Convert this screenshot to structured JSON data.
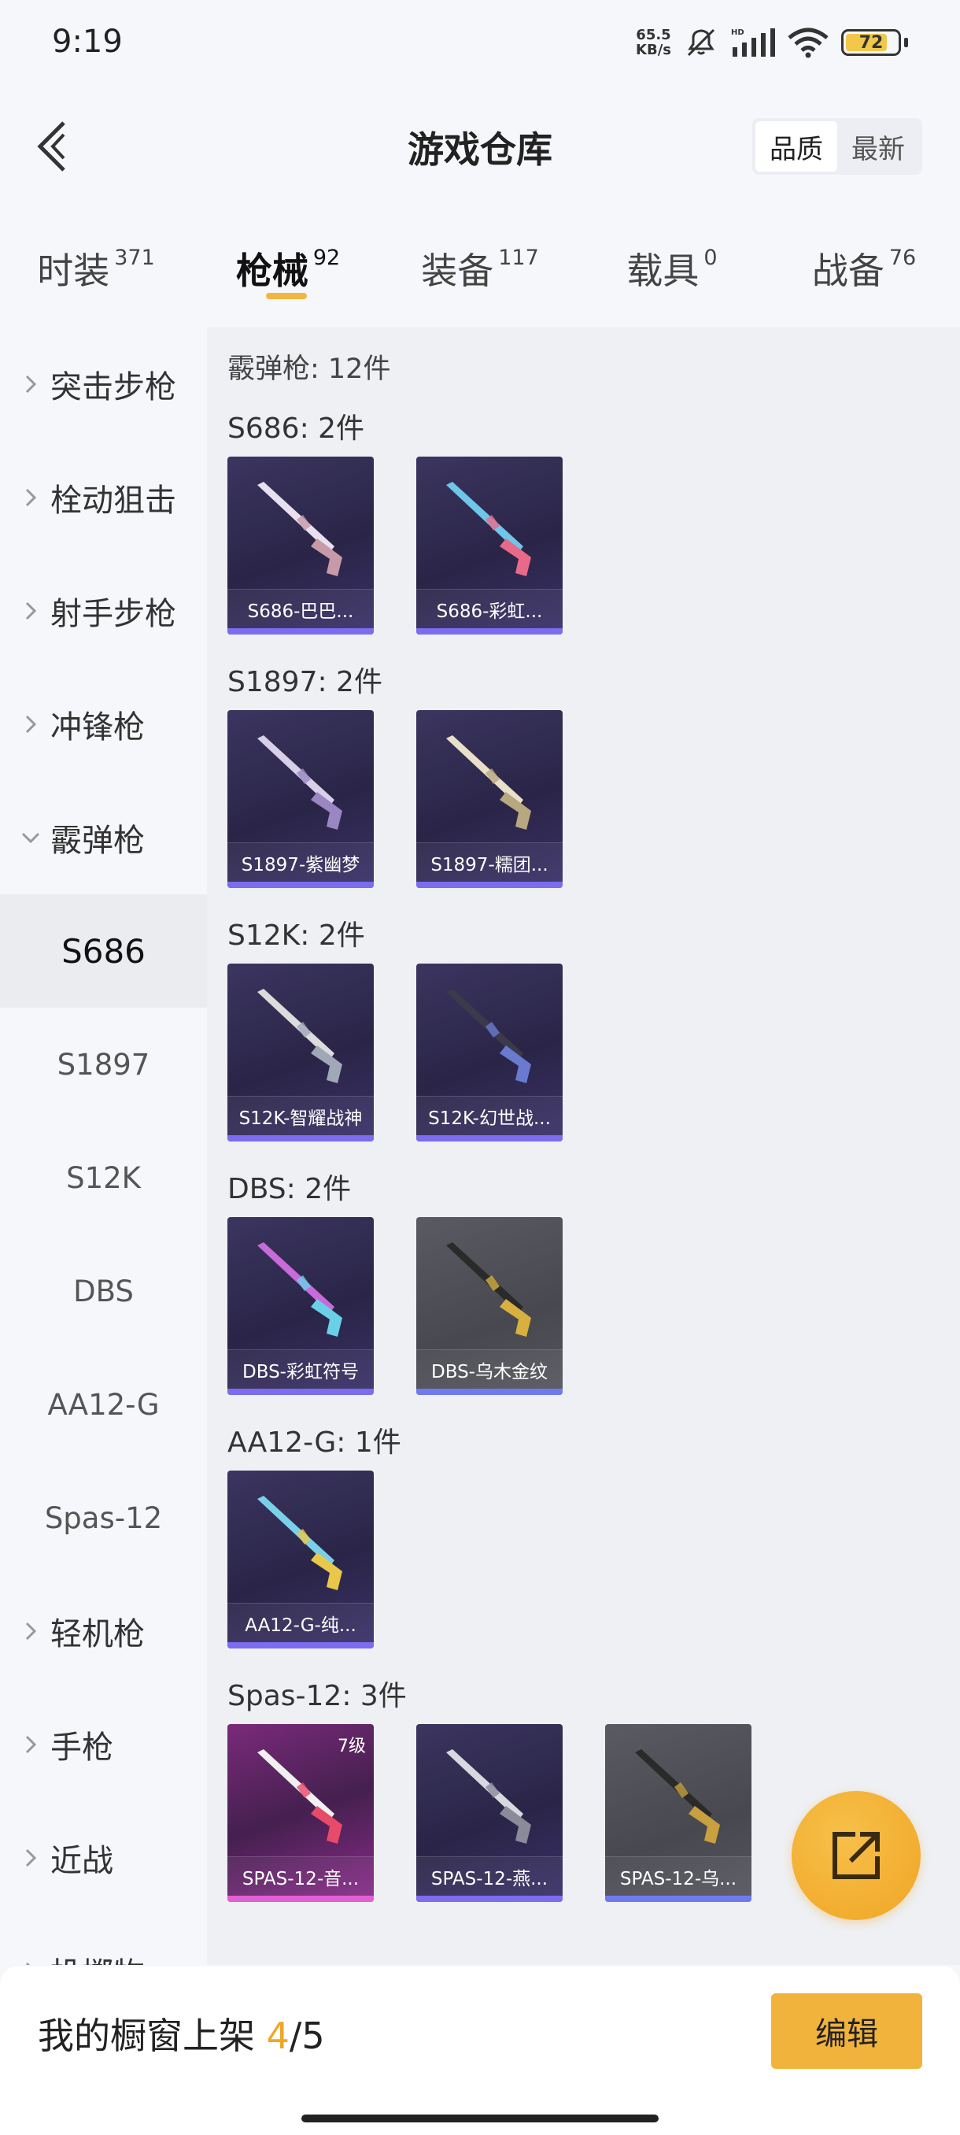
{
  "status": {
    "time": "9:19",
    "net_speed": "65.5",
    "net_unit": "KB/s",
    "battery": "72"
  },
  "header": {
    "title": "游戏仓库",
    "sort_options": [
      "品质",
      "最新"
    ]
  },
  "tabs": [
    {
      "label": "时装",
      "count": "371"
    },
    {
      "label": "枪械",
      "count": "92"
    },
    {
      "label": "装备",
      "count": "117"
    },
    {
      "label": "载具",
      "count": "0"
    },
    {
      "label": "战备",
      "count": "76"
    }
  ],
  "sidebar": {
    "categories": [
      "突击步枪",
      "栓动狙击",
      "射手步枪",
      "冲锋枪",
      "霰弹枪",
      "轻机枪",
      "手枪",
      "近战",
      "投掷物"
    ],
    "subs": [
      "S686",
      "S1897",
      "S12K",
      "DBS",
      "AA12-G",
      "Spas-12"
    ]
  },
  "content": {
    "total": "霰弹枪: 12件",
    "groups": [
      {
        "head": "S686: 2件",
        "items": [
          {
            "name": "S686-巴巴...",
            "style": "purple",
            "weapon": "shotgun-double"
          },
          {
            "name": "S686-彩虹...",
            "style": "purple",
            "weapon": "shotgun-double-rainbow"
          }
        ]
      },
      {
        "head": "S1897: 2件",
        "items": [
          {
            "name": "S1897-紫幽梦",
            "style": "purple",
            "weapon": "pump-shotgun"
          },
          {
            "name": "S1897-糯团...",
            "style": "purple",
            "weapon": "pump-shotgun-cream"
          }
        ]
      },
      {
        "head": "S12K: 2件",
        "items": [
          {
            "name": "S12K-智耀战神",
            "style": "purple",
            "weapon": "auto-shotgun"
          },
          {
            "name": "S12K-幻世战...",
            "style": "purple",
            "weapon": "auto-shotgun-dark"
          }
        ]
      },
      {
        "head": "DBS: 2件",
        "items": [
          {
            "name": "DBS-彩虹符号",
            "style": "purple",
            "weapon": "bullpup-shotgun-rainbow"
          },
          {
            "name": "DBS-乌木金纹",
            "style": "gray",
            "weapon": "bullpup-shotgun-gold"
          }
        ]
      },
      {
        "head": "AA12-G: 1件",
        "items": [
          {
            "name": "AA12-G-纯...",
            "style": "purple",
            "weapon": "aa12-shotgun"
          }
        ]
      },
      {
        "head": "Spas-12: 3件",
        "items": [
          {
            "name": "SPAS-12-音...",
            "style": "pink",
            "weapon": "spas-shotgun-music",
            "badge": "7级"
          },
          {
            "name": "SPAS-12-燕...",
            "style": "purple",
            "weapon": "spas-shotgun-silver"
          },
          {
            "name": "SPAS-12-乌...",
            "style": "gray",
            "weapon": "spas-shotgun-gold"
          }
        ]
      }
    ]
  },
  "bottom": {
    "shelf_prefix": "我的橱窗上架",
    "shelf_current": "4",
    "shelf_total": "/5",
    "edit_label": "编辑"
  },
  "colors": {
    "accent": "#f1b33c",
    "card_purple": "#2a2547",
    "card_gray": "#48484f",
    "card_pink": "#7a2a7a"
  }
}
